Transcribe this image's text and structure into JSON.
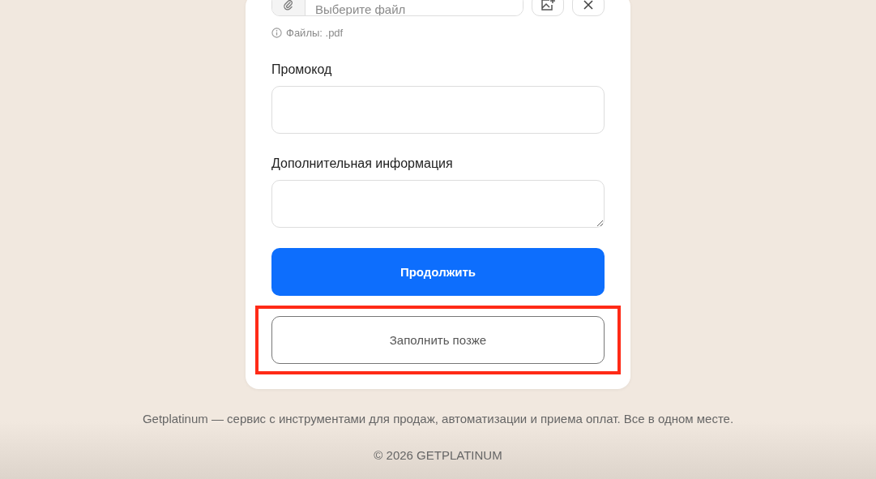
{
  "file_field": {
    "placeholder": "Выберите файл",
    "hint": "Файлы: .pdf"
  },
  "promo": {
    "label": "Промокод"
  },
  "extra_info": {
    "label": "Дополнительная информация"
  },
  "buttons": [
    {
      "label": "Продолжить",
      "kind": "primary",
      "highlighted": false
    },
    {
      "label": "Заполнить позже",
      "kind": "secondary",
      "highlighted": true
    }
  ],
  "footer": {
    "tagline": "Getplatinum — сервис с инструментами для продаж, автоматизации и приема оплат. Все в одном месте.",
    "copyright": "© 2026 GETPLATINUM"
  }
}
